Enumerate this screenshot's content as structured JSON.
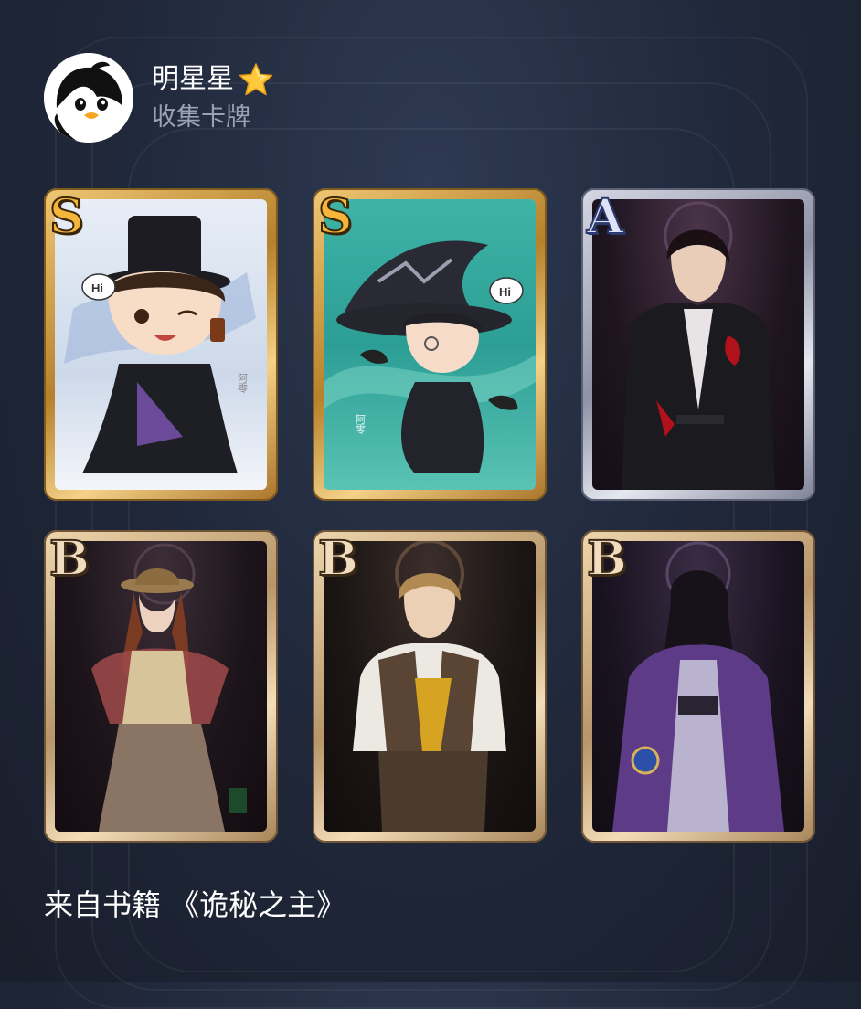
{
  "user": {
    "name": "明星星",
    "subtitle": "收集卡牌",
    "avatar_icon": "penguin-avatar-icon",
    "name_badge_icon": "star-icon"
  },
  "cards": [
    {
      "rank": "S",
      "art": "chibi-top-hat-gentleman",
      "bubble": "Hi",
      "signature": "阿零"
    },
    {
      "rank": "S",
      "art": "chibi-witch-hat-character",
      "bubble": "Hi",
      "signature": "阿零"
    },
    {
      "rank": "A",
      "art": "gentleman-black-coat"
    },
    {
      "rank": "B",
      "art": "lady-hat-shawl"
    },
    {
      "rank": "B",
      "art": "blond-adventurer"
    },
    {
      "rank": "B",
      "art": "purple-coat-woman"
    }
  ],
  "footer": {
    "source": "来自书籍 《诡秘之主》"
  },
  "colors": {
    "background": "#1f2739",
    "s_rank": "#f4b63a",
    "a_rank": "#dfe3f5",
    "b_rank": "#f1dcc0"
  }
}
